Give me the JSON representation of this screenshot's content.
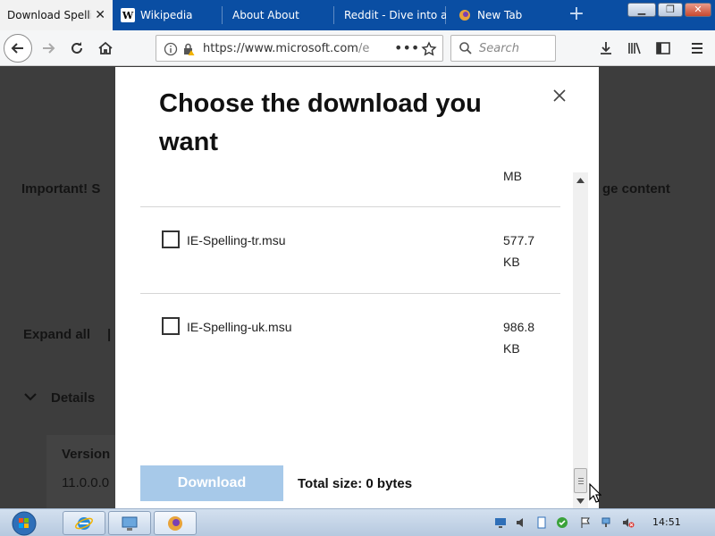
{
  "browser": {
    "tabs": [
      {
        "label": "Download Spelli",
        "active": true
      },
      {
        "label": "Wikipedia",
        "active": false
      },
      {
        "label": "About About",
        "active": false
      },
      {
        "label": "Reddit - Dive into a",
        "active": false
      },
      {
        "label": "New Tab",
        "active": false
      }
    ],
    "url_host": "https://www.microsoft.com",
    "url_rest": "/e",
    "search_placeholder": "Search"
  },
  "page": {
    "important_left": "Important! S",
    "important_right": "ge content",
    "expand_all": "Expand all",
    "expand_sep": "|",
    "details": "Details",
    "version_label": "Version",
    "version_value": "11.0.0.0"
  },
  "modal": {
    "title": "Choose the download you want",
    "partial_size_tail": "MB",
    "files": [
      {
        "name": "IE-Spelling-tr.msu",
        "size_num": "577.7",
        "size_unit": "KB",
        "checked": false
      },
      {
        "name": "IE-Spelling-uk.msu",
        "size_num": "986.8",
        "size_unit": "KB",
        "checked": false
      }
    ],
    "download_label": "Download",
    "total_size": "Total size: 0 bytes",
    "scroll_position_percent": 100
  },
  "taskbar": {
    "clock": "14:51"
  },
  "colors": {
    "tab_strip": "#0a4ea3",
    "download_button_disabled": "#a7c9e9",
    "overlay": "#3d3d3d"
  }
}
